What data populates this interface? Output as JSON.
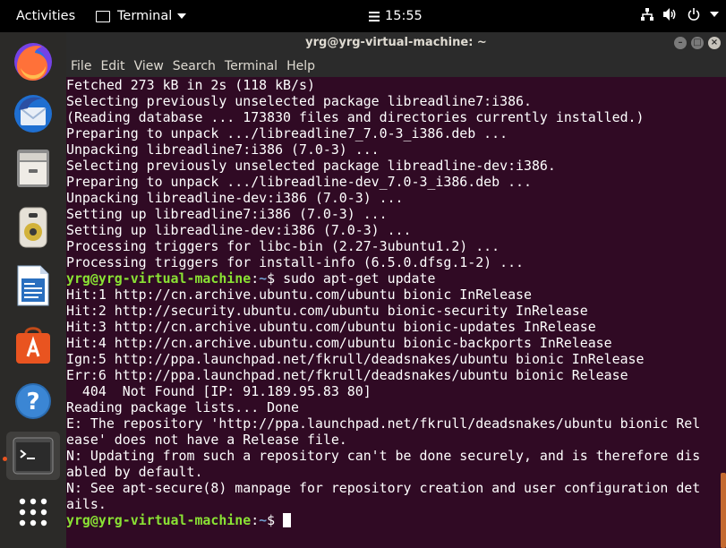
{
  "topbar": {
    "activities": "Activities",
    "app_name": "Terminal",
    "clock": "15:55",
    "icons": [
      "network-icon",
      "volume-icon",
      "power-icon",
      "chevron-down-icon"
    ]
  },
  "dock": {
    "apps": [
      {
        "name": "firefox",
        "icon": "firefox-icon"
      },
      {
        "name": "thunderbird",
        "icon": "thunderbird-icon"
      },
      {
        "name": "files",
        "icon": "files-icon"
      },
      {
        "name": "rhythmbox",
        "icon": "rhythmbox-icon"
      },
      {
        "name": "libreoffice-writer",
        "icon": "writer-icon"
      },
      {
        "name": "software",
        "icon": "software-center-icon"
      },
      {
        "name": "help",
        "icon": "help-icon"
      },
      {
        "name": "terminal",
        "icon": "terminal-icon"
      },
      {
        "name": "show-applications",
        "icon": "app-grid-icon"
      }
    ],
    "colors": {
      "accent": "#e95420"
    }
  },
  "window": {
    "title": "yrg@yrg-virtual-machine: ~",
    "menu": [
      "File",
      "Edit",
      "View",
      "Search",
      "Terminal",
      "Help"
    ]
  },
  "terminal": {
    "colors": {
      "background": "#300a24",
      "user": "#8ae234",
      "path": "#729fcf"
    },
    "prompt_user": "yrg@yrg-virtual-machine",
    "prompt_path": "~",
    "prompt_symbol": "$",
    "command": "sudo apt-get update",
    "lines_before": [
      "Fetched 273 kB in 2s (118 kB/s)",
      "Selecting previously unselected package libreadline7:i386.",
      "(Reading database ... 173830 files and directories currently installed.)",
      "Preparing to unpack .../libreadline7_7.0-3_i386.deb ...",
      "Unpacking libreadline7:i386 (7.0-3) ...",
      "Selecting previously unselected package libreadline-dev:i386.",
      "Preparing to unpack .../libreadline-dev_7.0-3_i386.deb ...",
      "Unpacking libreadline-dev:i386 (7.0-3) ...",
      "Setting up libreadline7:i386 (7.0-3) ...",
      "Setting up libreadline-dev:i386 (7.0-3) ...",
      "Processing triggers for libc-bin (2.27-3ubuntu1.2) ...",
      "Processing triggers for install-info (6.5.0.dfsg.1-2) ..."
    ],
    "lines_after": [
      "Hit:1 http://cn.archive.ubuntu.com/ubuntu bionic InRelease",
      "Hit:2 http://security.ubuntu.com/ubuntu bionic-security InRelease",
      "Hit:3 http://cn.archive.ubuntu.com/ubuntu bionic-updates InRelease",
      "Hit:4 http://cn.archive.ubuntu.com/ubuntu bionic-backports InRelease",
      "Ign:5 http://ppa.launchpad.net/fkrull/deadsnakes/ubuntu bionic InRelease",
      "Err:6 http://ppa.launchpad.net/fkrull/deadsnakes/ubuntu bionic Release",
      "  404  Not Found [IP: 91.189.95.83 80]",
      "Reading package lists... Done",
      "E: The repository 'http://ppa.launchpad.net/fkrull/deadsnakes/ubuntu bionic Rel",
      "ease' does not have a Release file.",
      "N: Updating from such a repository can't be done securely, and is therefore dis",
      "abled by default.",
      "N: See apt-secure(8) manpage for repository creation and user configuration det",
      "ails."
    ]
  }
}
